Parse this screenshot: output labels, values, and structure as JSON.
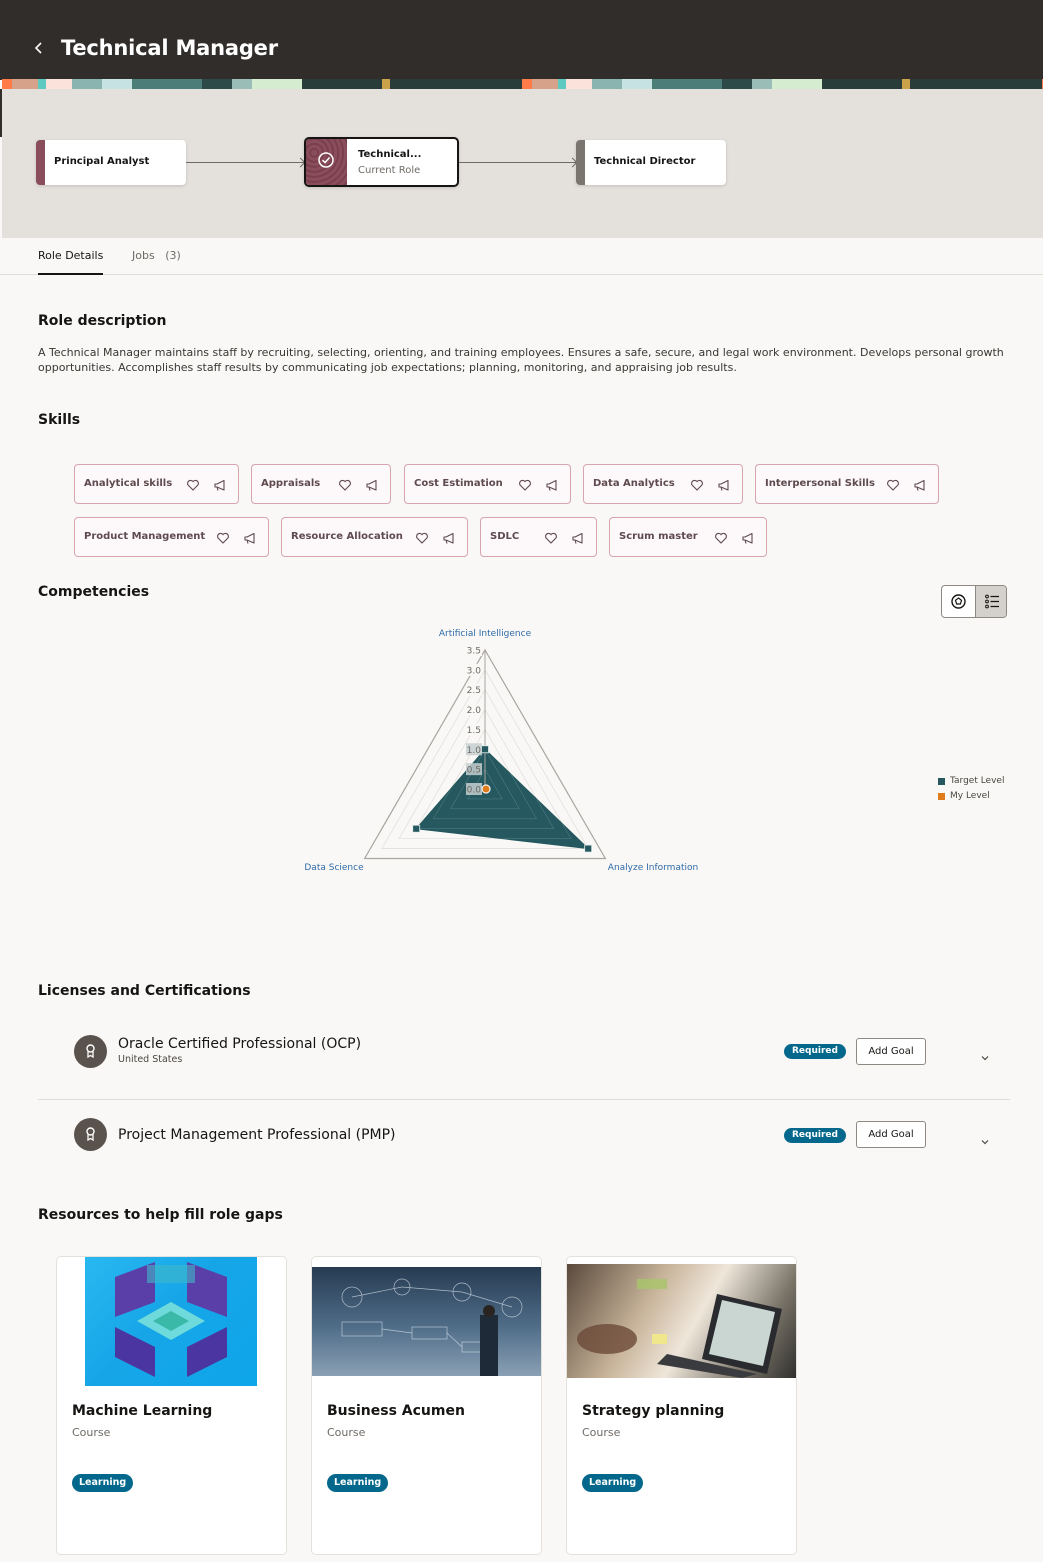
{
  "header": {
    "title": "Technical Manager",
    "back_icon": "chevron-left-icon"
  },
  "career_path": {
    "roles": [
      {
        "name": "Principal Analyst",
        "status": "previous",
        "color": "#8a4d5c"
      },
      {
        "name": "Technical...",
        "subtitle": "Current Role",
        "status": "current",
        "color": "#8a4d5c",
        "icon": "check-circle-icon"
      },
      {
        "name": "Technical Director",
        "status": "next",
        "color": "#7b7570"
      }
    ]
  },
  "tabs": [
    {
      "label": "Role Details",
      "active": true
    },
    {
      "label": "Jobs",
      "count": "(3)",
      "active": false
    }
  ],
  "role_description": {
    "title": "Role description",
    "text": "A Technical Manager maintains staff by recruiting, selecting, orienting, and training employees. Ensures a safe, secure, and legal work environment. Develops personal growth opportunities. Accomplishes staff results by communicating job expectations; planning, monitoring, and appraising job results."
  },
  "skills": {
    "title": "Skills",
    "items": [
      "Analytical skills",
      "Appraisals",
      "Cost Estimation",
      "Data Analytics",
      "Interpersonal Skills",
      "Product Management",
      "Resource Allocation",
      "SDLC",
      "Scrum master"
    ],
    "icons": [
      "heart-icon",
      "megaphone-icon"
    ]
  },
  "competencies": {
    "title": "Competencies",
    "view_toggle": {
      "options": [
        "radar-view",
        "list-view"
      ],
      "selected": "list-view"
    }
  },
  "chart_data": {
    "type": "radar",
    "axes": [
      "Artificial Intelligence",
      "Analyze Information",
      "Data Science"
    ],
    "radial_ticks": [
      "0.0",
      "0.5",
      "1.0",
      "1.5",
      "2.0",
      "2.5",
      "3.0",
      "3.5"
    ],
    "rlim": [
      0,
      3.5
    ],
    "series": [
      {
        "name": "Target Level",
        "color": "#25585f",
        "values": [
          1.0,
          3.0,
          2.0
        ]
      },
      {
        "name": "My Level",
        "color": "#e07b1a",
        "values": [
          0,
          0,
          0
        ]
      }
    ],
    "legend": "right"
  },
  "licenses": {
    "title": "Licenses and Certifications",
    "items": [
      {
        "name": "Oracle Certified Professional (OCP)",
        "sub": "United States",
        "badge": "Required",
        "action": "Add Goal"
      },
      {
        "name": "Project Management Professional (PMP)",
        "sub": "",
        "badge": "Required",
        "action": "Add Goal"
      }
    ]
  },
  "resources": {
    "title": "Resources to help fill role gaps",
    "items": [
      {
        "title": "Machine Learning",
        "type": "Course",
        "badge": "Learning"
      },
      {
        "title": "Business Acumen",
        "type": "Course",
        "badge": "Learning"
      },
      {
        "title": "Strategy planning",
        "type": "Course",
        "badge": "Learning"
      }
    ]
  }
}
